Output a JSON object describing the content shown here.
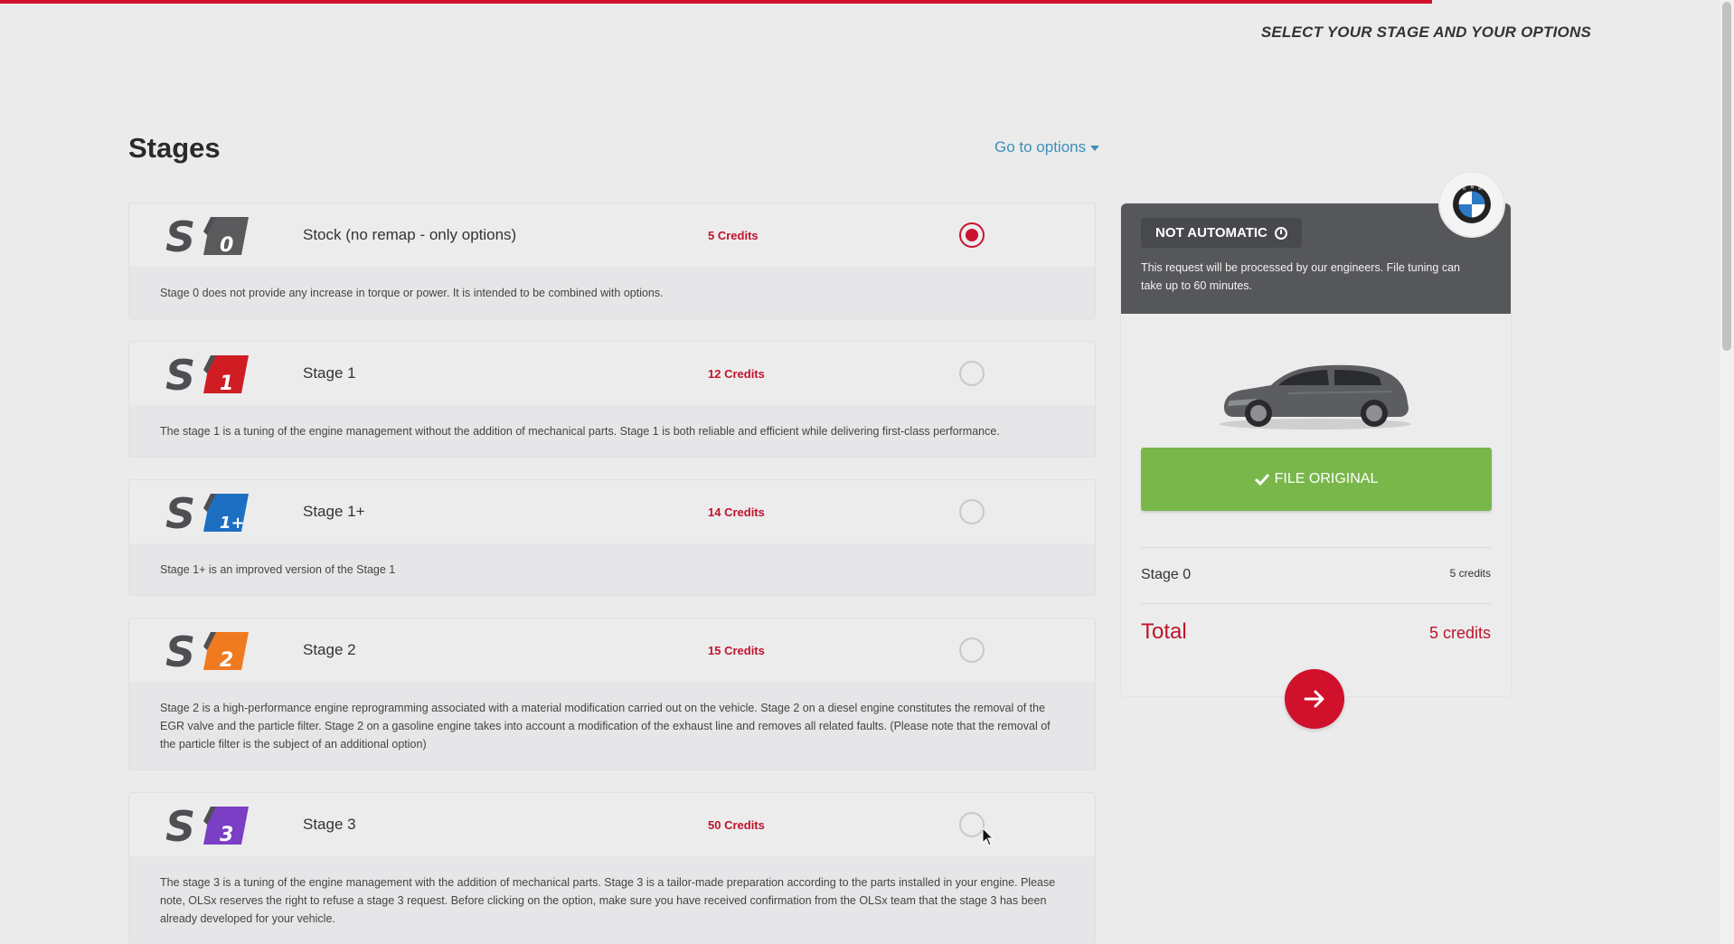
{
  "progress": {
    "fraction": 0.826,
    "color": "#d0112b"
  },
  "header": {
    "title": "SELECT YOUR STAGE AND YOUR OPTIONS"
  },
  "stages_section": {
    "title": "Stages",
    "go_to_options": "Go to options"
  },
  "stages": [
    {
      "logo_label": "S0",
      "logo_color": "#5a5a5c",
      "name": "Stock (no remap - only options)",
      "credits": "5 Credits",
      "selected": true,
      "description": "Stage 0 does not provide any increase in torque or power. It is intended to be combined with options."
    },
    {
      "logo_label": "S1",
      "logo_color": "#cf1d23",
      "name": "Stage 1",
      "credits": "12 Credits",
      "selected": false,
      "description": "The stage 1 is a tuning of the engine management without the addition of mechanical parts. Stage 1 is both reliable and efficient while delivering first-class performance."
    },
    {
      "logo_label": "S1+",
      "logo_color": "#1d6fc2",
      "name": "Stage 1+",
      "credits": "14 Credits",
      "selected": false,
      "description": "Stage 1+ is an improved version of the Stage 1"
    },
    {
      "logo_label": "S2",
      "logo_color": "#f07a1f",
      "name": "Stage 2",
      "credits": "15 Credits",
      "selected": false,
      "description": "Stage 2 is a high-performance engine reprogramming associated with a material modification carried out on the vehicle. Stage 2 on a diesel engine constitutes the removal of the EGR valve and the particle filter. Stage 2 on a gasoline engine takes into account a modification of the exhaust line and removes all related faults. (Please note that the removal of the particle filter is the subject of an additional option)"
    },
    {
      "logo_label": "S3",
      "logo_color": "#7a3fc4",
      "name": "Stage 3",
      "credits": "50 Credits",
      "selected": false,
      "description": "The stage 3 is a tuning of the engine management with the addition of mechanical parts. Stage 3 is a tailor-made preparation according to the parts installed in your engine. Please note, OLSx reserves the right to refuse a stage 3 request. Before clicking on the option, make sure you have received confirmation from the OLSx team that the stage 3 has been already developed for your vehicle."
    }
  ],
  "panel": {
    "badge": "NOT AUTOMATIC",
    "note": "This request will be processed by our engineers. File tuning can take up to 60 minutes.",
    "brand_icon": "bmw-logo",
    "file_button": "FILE ORIGINAL",
    "line_item": {
      "label": "Stage 0",
      "value": "5 credits"
    },
    "total": {
      "label": "Total",
      "value": "5 credits"
    },
    "next_icon": "arrow-right-icon"
  },
  "colors": {
    "accent": "#d0112b",
    "green": "#79b74b",
    "link": "#3b8fb8"
  }
}
